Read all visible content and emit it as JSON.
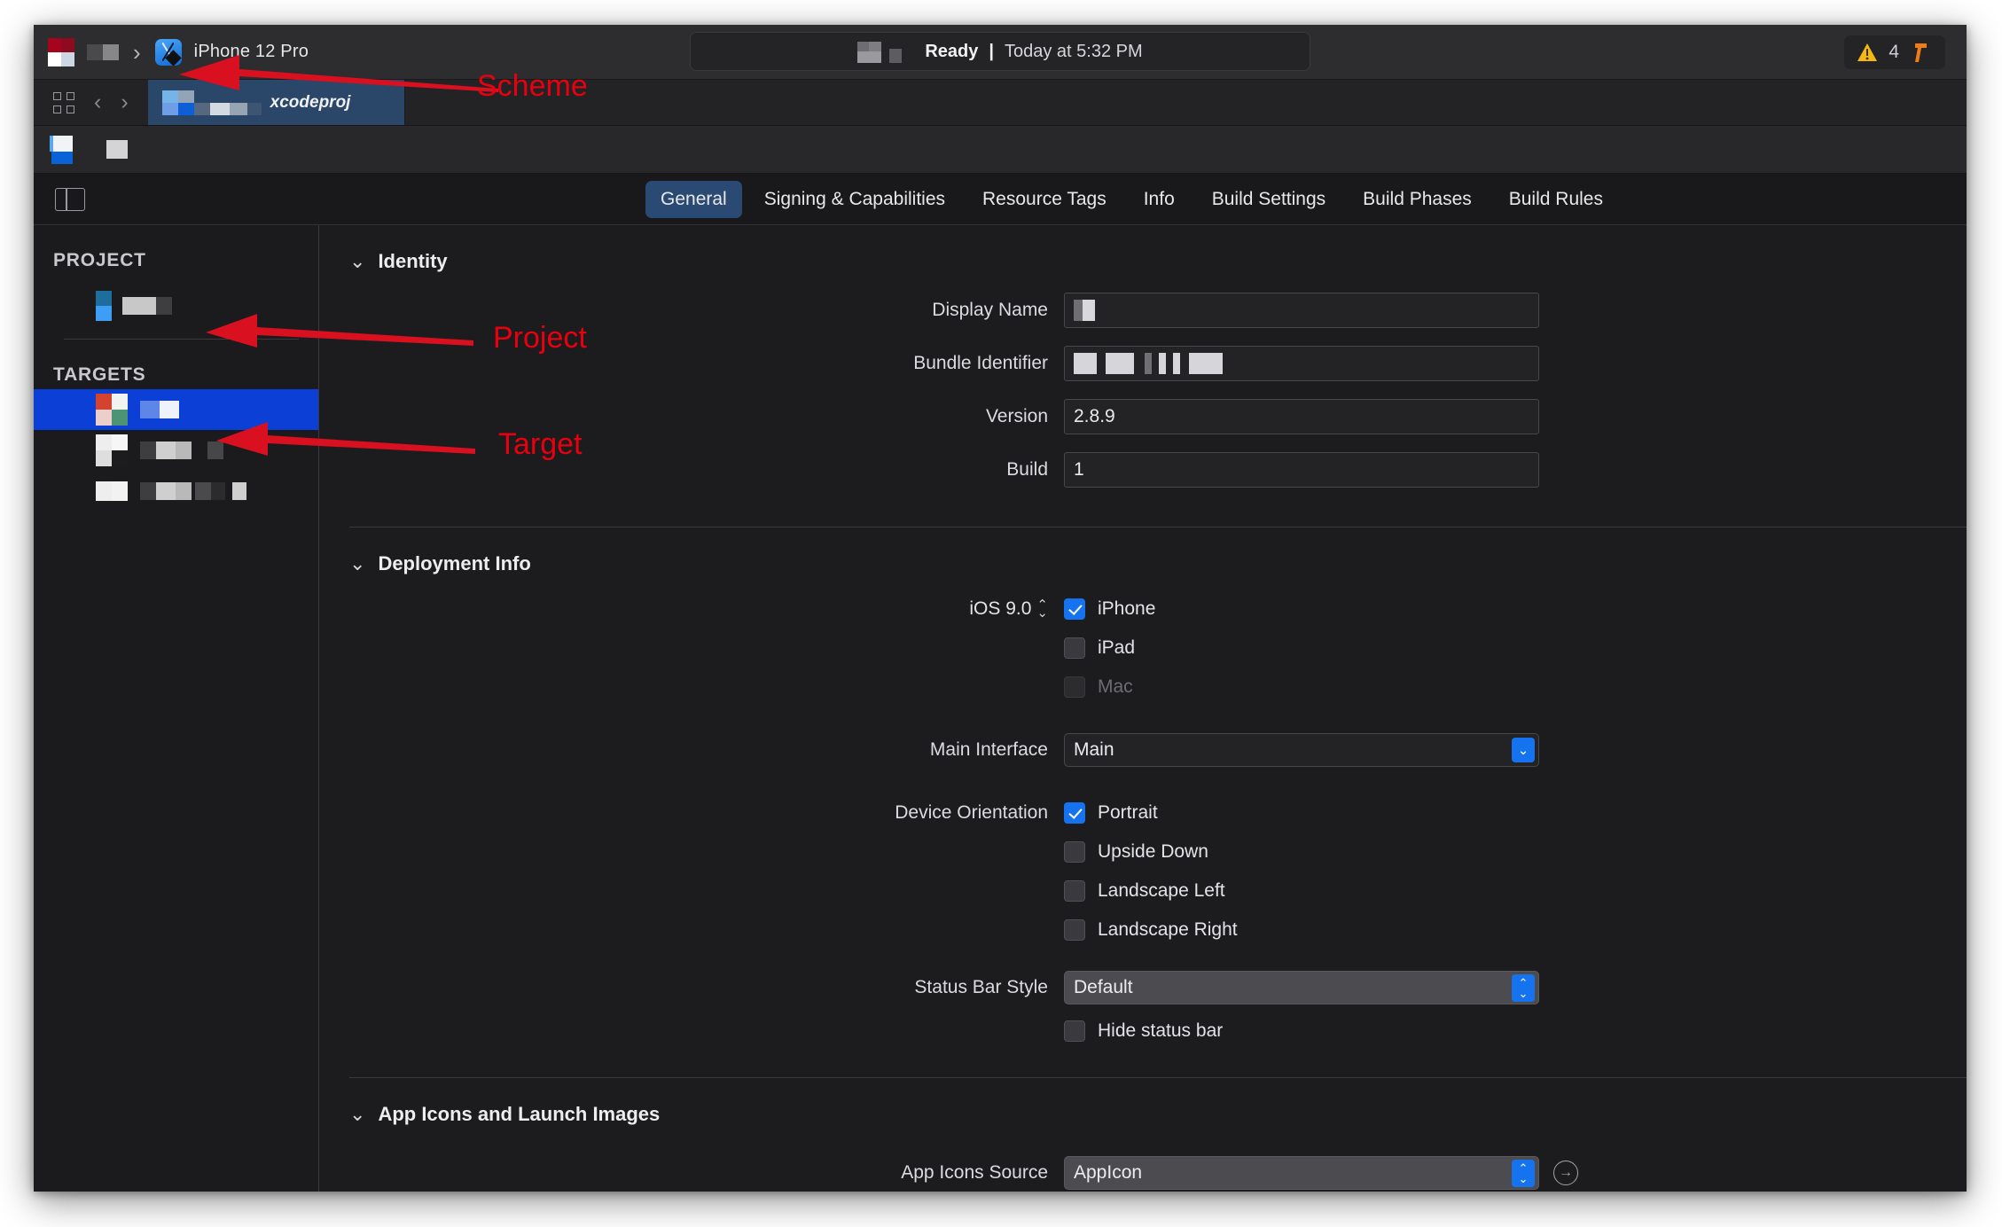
{
  "window": {
    "toolbar": {
      "run_icon": "run-button-icon",
      "stop_icon": "stop-button-icon",
      "breadcrumb_separator": "›",
      "scheme_icon": "xcode-app-icon",
      "scheme_destination": "iPhone 12 Pro",
      "status": {
        "state": "Ready",
        "separator": "|",
        "timestamp": "Today at 5:32 PM"
      },
      "warnings_count": "4",
      "warning_icon": "warning-triangle-icon",
      "build_icon": "hammer-icon"
    },
    "tabbar": {
      "grid_icon": "tab-overview-icon",
      "back_chevron": "‹",
      "forward_chevron": "›",
      "tab_label": "xcodeproj"
    },
    "editor_tabs": {
      "sidebar_toggle_icon": "sidebar-toggle-icon",
      "items": [
        {
          "label": "General",
          "active": true
        },
        {
          "label": "Signing & Capabilities",
          "active": false
        },
        {
          "label": "Resource Tags",
          "active": false
        },
        {
          "label": "Info",
          "active": false
        },
        {
          "label": "Build Settings",
          "active": false
        },
        {
          "label": "Build Phases",
          "active": false
        },
        {
          "label": "Build Rules",
          "active": false
        }
      ]
    },
    "sidebar": {
      "project_header": "PROJECT",
      "targets_header": "TARGETS"
    },
    "content": {
      "identity": {
        "title": "Identity",
        "disclosure": "⌄",
        "fields": [
          {
            "label": "Display Name",
            "value": ""
          },
          {
            "label": "Bundle Identifier",
            "value": ""
          },
          {
            "label": "Version",
            "value": "2.8.9"
          },
          {
            "label": "Build",
            "value": "1"
          }
        ]
      },
      "deployment": {
        "title": "Deployment Info",
        "disclosure": "⌄",
        "deployment_target": "iOS 9.0",
        "devices": [
          {
            "label": "iPhone",
            "checked": true,
            "disabled": false
          },
          {
            "label": "iPad",
            "checked": false,
            "disabled": false
          },
          {
            "label": "Mac",
            "checked": false,
            "disabled": true
          }
        ],
        "main_interface_label": "Main Interface",
        "main_interface_value": "Main",
        "device_orientation_label": "Device Orientation",
        "orientations": [
          {
            "label": "Portrait",
            "checked": true
          },
          {
            "label": "Upside Down",
            "checked": false
          },
          {
            "label": "Landscape Left",
            "checked": false
          },
          {
            "label": "Landscape Right",
            "checked": false
          }
        ],
        "status_bar_style_label": "Status Bar Style",
        "status_bar_style_value": "Default",
        "hide_status_bar_label": "Hide status bar",
        "hide_status_bar_checked": false
      },
      "app_icons": {
        "title": "App Icons and Launch Images",
        "disclosure": "⌄",
        "source_label": "App Icons Source",
        "source_value": "AppIcon",
        "reveal_icon": "arrow-right-circle-icon"
      }
    }
  },
  "annotations": {
    "color": "#e8000f",
    "labels": [
      {
        "text": "Scheme"
      },
      {
        "text": "Project"
      },
      {
        "text": "Target"
      }
    ]
  }
}
